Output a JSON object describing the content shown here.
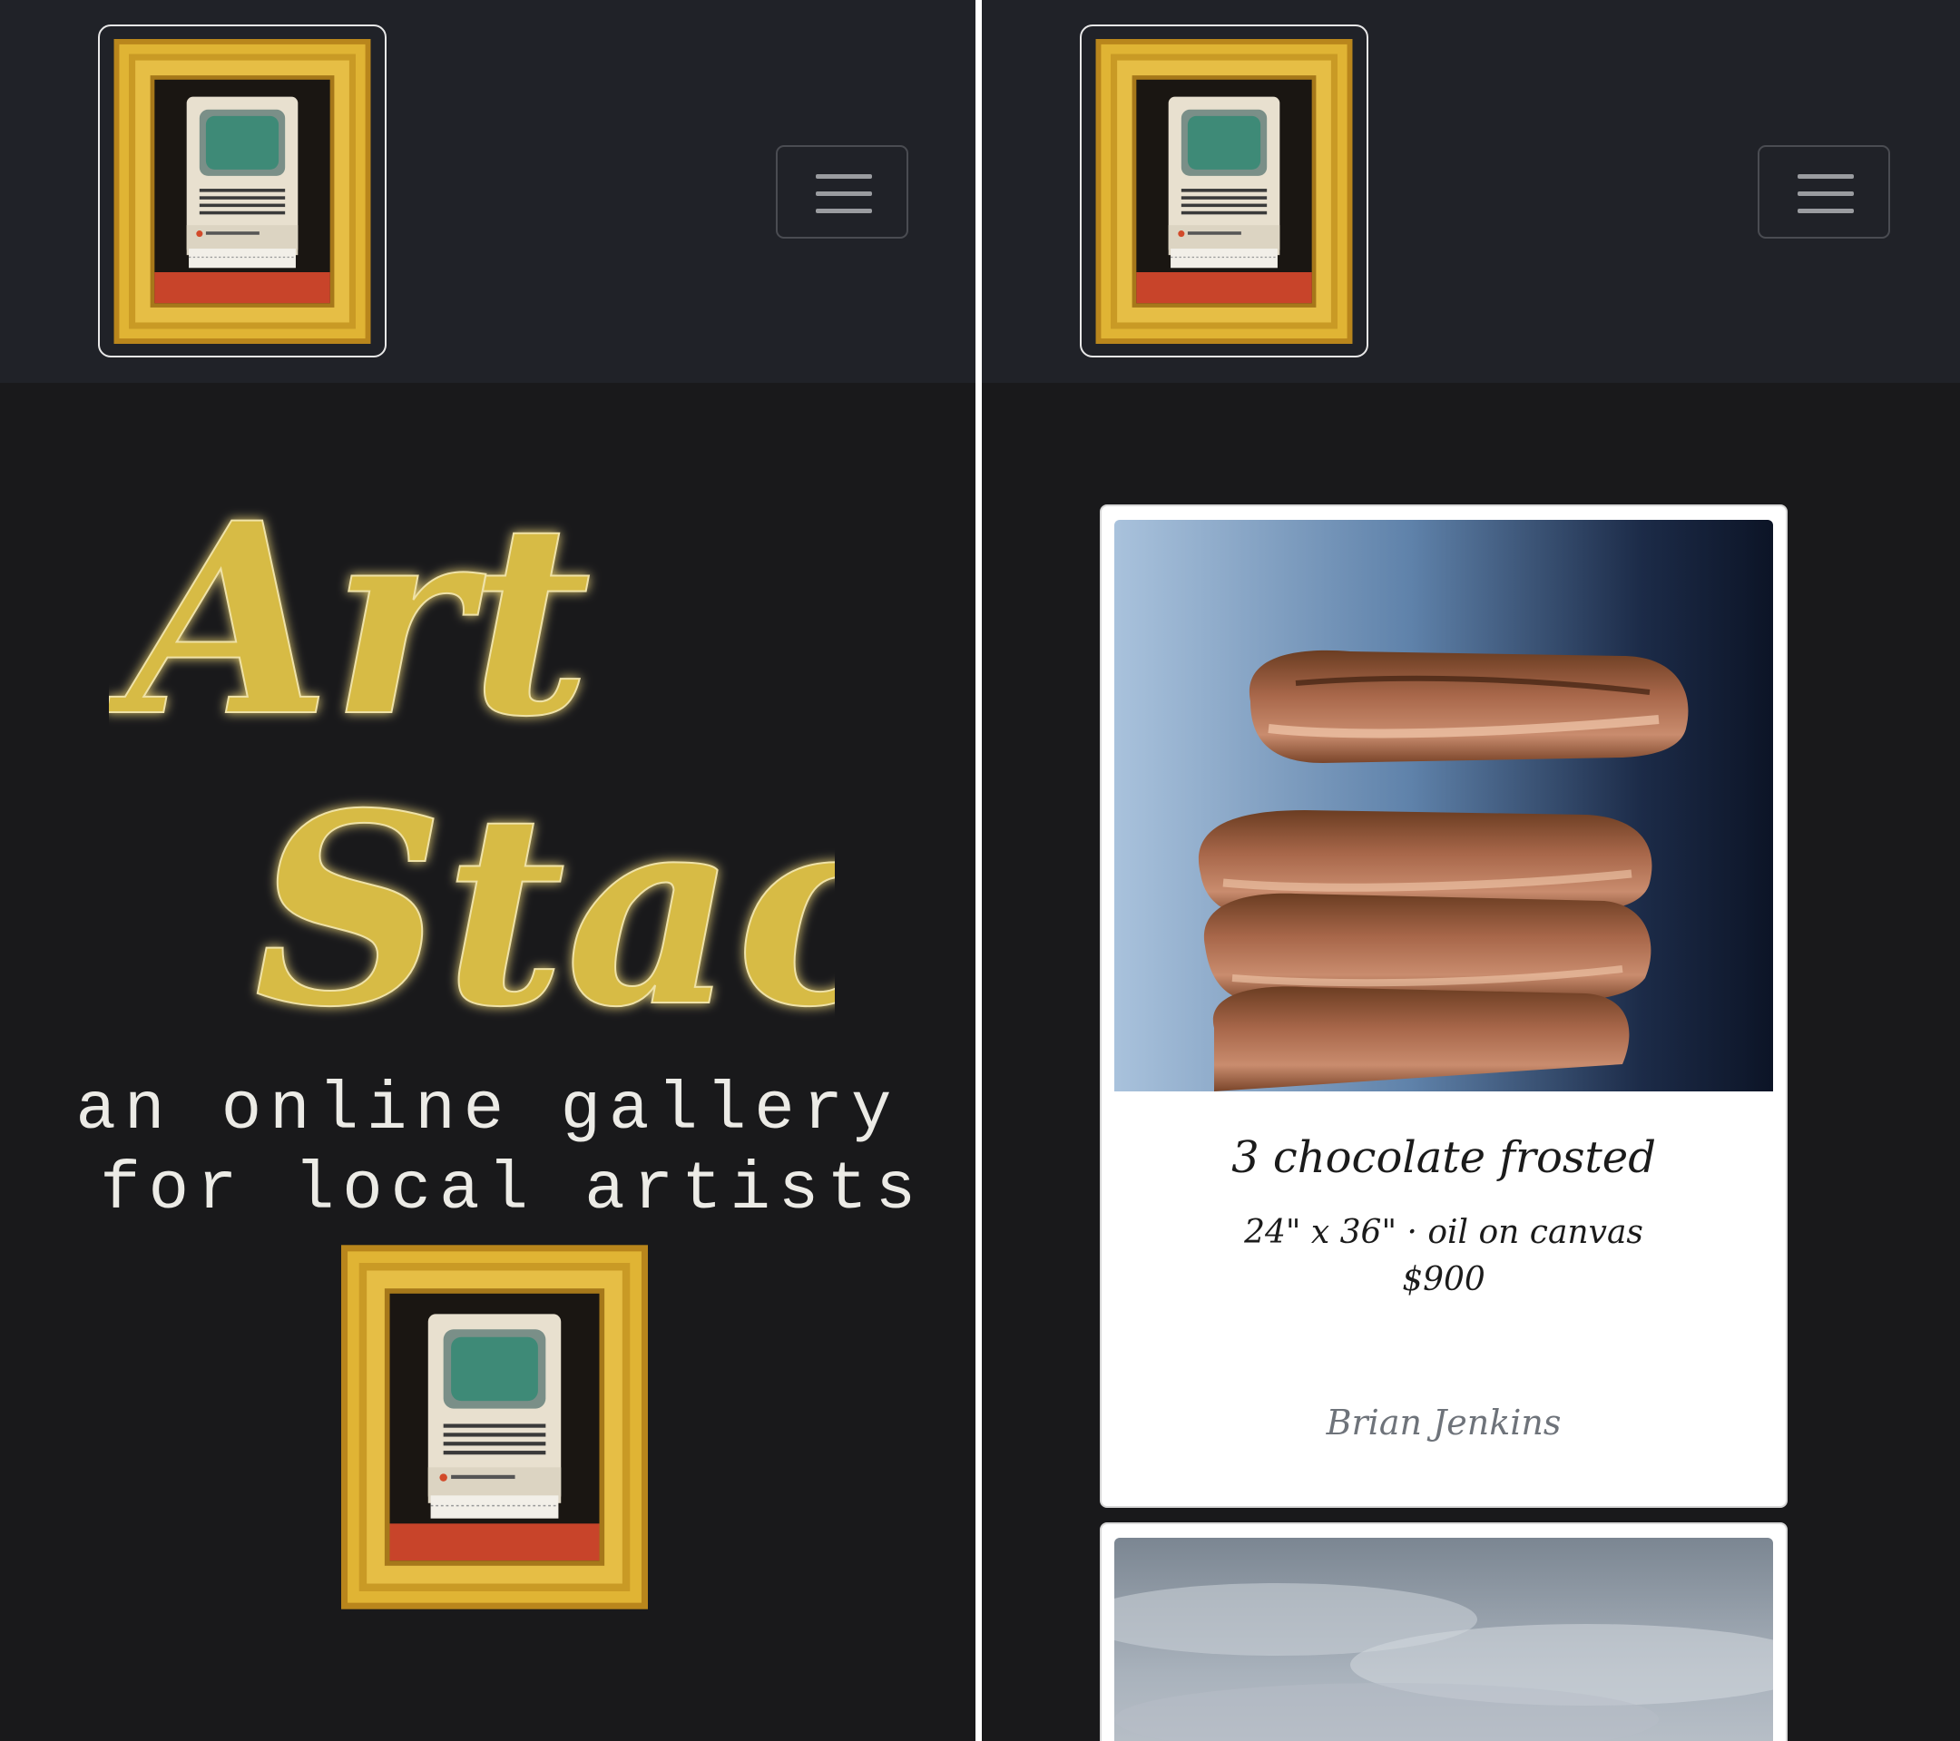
{
  "left_screen": {
    "navbar": {
      "logo_alt": "Art Stack logo",
      "menu_icon": "hamburger-menu-icon"
    },
    "hero": {
      "title_line1": "Art",
      "title_line2": "Stack",
      "tagline_line1": "an online gallery",
      "tagline_line2": " for local artists"
    }
  },
  "right_screen": {
    "navbar": {
      "logo_alt": "Art Stack logo",
      "menu_icon": "hamburger-menu-icon"
    },
    "artworks": [
      {
        "title": "3 chocolate frosted",
        "dimensions": "24\" x 36\" · oil on canvas",
        "price": "$900",
        "artist": "Brian Jenkins"
      }
    ]
  },
  "colors": {
    "navbar_bg": "#202228",
    "page_bg": "#19191b",
    "title_gold": "#d7bb45",
    "frame_gold": "#d4a52a",
    "tagline_color": "#ecebe6",
    "artist_gray": "#6e737a"
  }
}
